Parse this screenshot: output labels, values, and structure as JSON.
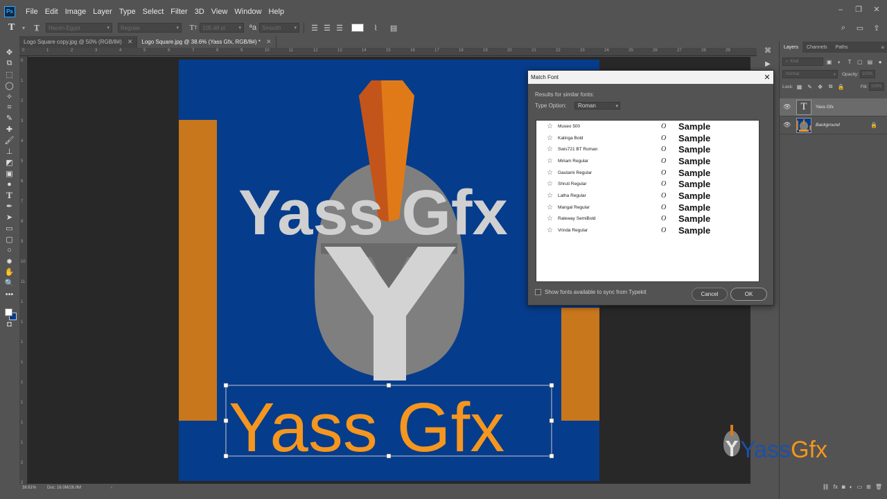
{
  "menubar": {
    "logo": "Ps",
    "items": [
      "File",
      "Edit",
      "Image",
      "Layer",
      "Type",
      "Select",
      "Filter",
      "3D",
      "View",
      "Window",
      "Help"
    ]
  },
  "options": {
    "font_family": "Hacen Egypt",
    "font_style": "Regular",
    "font_size": "105.48 pt",
    "antialias": "Smooth"
  },
  "tabs": [
    {
      "label": "Logo Square copy.jpg @ 50% (RGB/8#)",
      "active": false
    },
    {
      "label": "Logo Square.jpg @ 38.6% (Yass Gfx, RGB/8#) *",
      "active": true
    }
  ],
  "ruler_top_labels": [
    "0",
    "1",
    "2",
    "3",
    "4",
    "5",
    "6",
    "7",
    "8",
    "9",
    "10",
    "11",
    "12",
    "13",
    "14",
    "15",
    "16",
    "17",
    "18",
    "19",
    "20",
    "21",
    "22",
    "23",
    "24",
    "25",
    "26",
    "27",
    "28",
    "29"
  ],
  "ruler_left_labels": [
    "0",
    "1",
    "2",
    "3",
    "4",
    "5",
    "6",
    "7",
    "8",
    "9",
    "10",
    "11",
    "1",
    "1",
    "1",
    "1",
    "1",
    "1",
    "1",
    "1",
    "2",
    "2"
  ],
  "artwork": {
    "title_text": "Yass Gfx",
    "bottom_text": "Yass Gfx",
    "colors": {
      "background": "#063c8c",
      "orange": "#f5961e",
      "orange_dark": "#c8711a",
      "gray": "#7f7f7f",
      "light_gray": "#d3d3d3"
    }
  },
  "status": {
    "zoom": "38.61%",
    "doc": "Doc: 16.0M/26.0M"
  },
  "layers_panel": {
    "tabs": [
      "Layers",
      "Channels",
      "Paths"
    ],
    "kind_placeholder": "Kind",
    "blend_mode": "Normal",
    "opacity_label": "Opacity:",
    "opacity_value": "100%",
    "lock_label": "Lock:",
    "fill_label": "Fill:",
    "fill_value": "100%",
    "layers": [
      {
        "name": "Yass Gfx",
        "type": "text",
        "selected": true
      },
      {
        "name": "Background",
        "type": "image",
        "selected": false
      }
    ]
  },
  "dialog": {
    "title": "Match Font",
    "results_label": "Results for similar fonts:",
    "type_option_label": "Type Option:",
    "type_option_value": "Roman",
    "fonts": [
      {
        "name": "Museo 500",
        "sample": "Sample"
      },
      {
        "name": "Kalinga Bold",
        "sample": "Sample"
      },
      {
        "name": "Swis721 BT Roman",
        "sample": "Sample"
      },
      {
        "name": "Miriam Regular",
        "sample": "Sample"
      },
      {
        "name": "Gautami Regular",
        "sample": "Sample"
      },
      {
        "name": "Shruti Regular",
        "sample": "Sample"
      },
      {
        "name": "Latha Regular",
        "sample": "Sample"
      },
      {
        "name": "Mangal Regular",
        "sample": "Sample"
      },
      {
        "name": "Raleway SemiBold",
        "sample": "Sample"
      },
      {
        "name": "Vrinda Regular",
        "sample": "Sample"
      }
    ],
    "sync_label": "Show fonts available to sync from Typekit",
    "cancel_label": "Cancel",
    "ok_label": "OK"
  },
  "watermark": {
    "text": "YassGfx"
  }
}
